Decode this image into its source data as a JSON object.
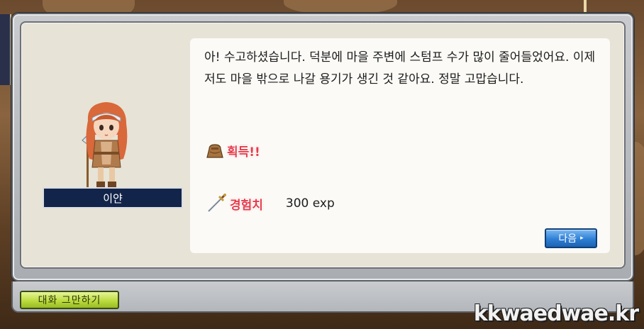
{
  "dialog": {
    "message": "아! 수고하셨습니다. 덕분에 마을 주변에 스텀프 수가 많이 줄어들었어요. 이제 저도 마을 밖으로 나갈 용기가 생긴 것 같아요. 정말 고맙습니다.",
    "reward_acquire_label": "획득!!",
    "exp_label": "경험치",
    "exp_value": "300 exp",
    "next_label": "다음",
    "next_arrow": "▸",
    "end_chat_label": "대화 그만하기"
  },
  "npc": {
    "name": "이얀"
  },
  "watermark": "kkwaedwae.kr",
  "colors": {
    "reward_label": "#e53c4a",
    "next_button": "#2d7fd6",
    "end_chat_button": "#b9d93a",
    "nameplate": "#13244a"
  },
  "icons": {
    "reward_icon": "item-bag-icon",
    "exp_icon": "sword-icon"
  }
}
